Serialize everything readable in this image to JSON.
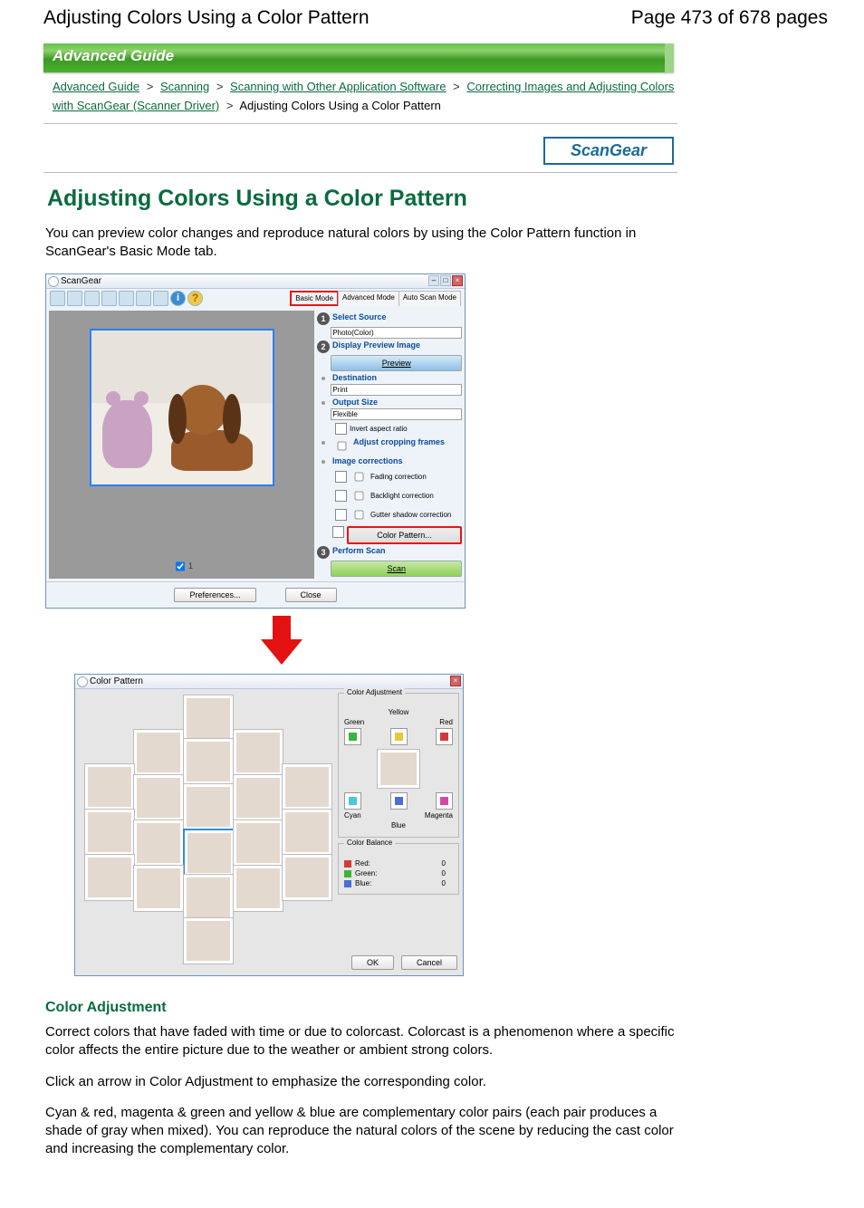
{
  "header": {
    "title": "Adjusting Colors Using a Color Pattern",
    "page": "Page 473 of 678 pages"
  },
  "banner": "Advanced Guide",
  "breadcrumb": {
    "items": [
      "Advanced Guide",
      "Scanning",
      "Scanning with Other Application Software",
      "Correcting Images and Adjusting Colors with ScanGear (Scanner Driver)"
    ],
    "current": "Adjusting Colors Using a Color Pattern",
    "sep": ">"
  },
  "badge": "ScanGear",
  "page_title": "Adjusting Colors Using a Color Pattern",
  "intro": "You can preview color changes and reproduce natural colors by using the Color Pattern function in ScanGear's Basic Mode tab.",
  "scangear_win": {
    "title": "ScanGear",
    "tabs": [
      "Basic Mode",
      "Advanced Mode",
      "Auto Scan Mode"
    ],
    "sections": {
      "select_source": {
        "label": "Select Source",
        "value": "Photo(Color)"
      },
      "preview": {
        "label": "Display Preview Image",
        "button": "Preview"
      },
      "destination": {
        "label": "Destination",
        "value": "Print"
      },
      "output_size": {
        "label": "Output Size",
        "value": "Flexible"
      },
      "invert": "Invert aspect ratio",
      "adjust_crop": "Adjust cropping frames",
      "image_corr": {
        "label": "Image corrections",
        "fading": "Fading correction",
        "backlight": "Backlight correction",
        "gutter": "Gutter shadow correction",
        "color_pattern": "Color Pattern..."
      },
      "perform": {
        "label": "Perform Scan",
        "button": "Scan"
      }
    },
    "preview_count": "1",
    "footer": {
      "prefs": "Preferences...",
      "close": "Close"
    }
  },
  "cp_win": {
    "title": "Color Pattern",
    "adjustment": {
      "legend": "Color Adjustment",
      "top": "Yellow",
      "tl": "Green",
      "tr": "Red",
      "bl": "Cyan",
      "br": "Magenta",
      "bottom": "Blue"
    },
    "balance": {
      "legend": "Color Balance",
      "red": {
        "label": "Red:",
        "value": "0"
      },
      "green": {
        "label": "Green:",
        "value": "0"
      },
      "blue": {
        "label": "Blue:",
        "value": "0"
      }
    },
    "footer": {
      "ok": "OK",
      "cancel": "Cancel"
    }
  },
  "section2": {
    "heading": "Color Adjustment",
    "p1": "Correct colors that have faded with time or due to colorcast. Colorcast is a phenomenon where a specific color affects the entire picture due to the weather or ambient strong colors.",
    "p2": "Click an arrow in Color Adjustment to emphasize the corresponding color.",
    "p3": "Cyan & red, magenta & green and yellow & blue are complementary color pairs (each pair produces a shade of gray when mixed). You can reproduce the natural colors of the scene by reducing the cast color and increasing the complementary color."
  }
}
